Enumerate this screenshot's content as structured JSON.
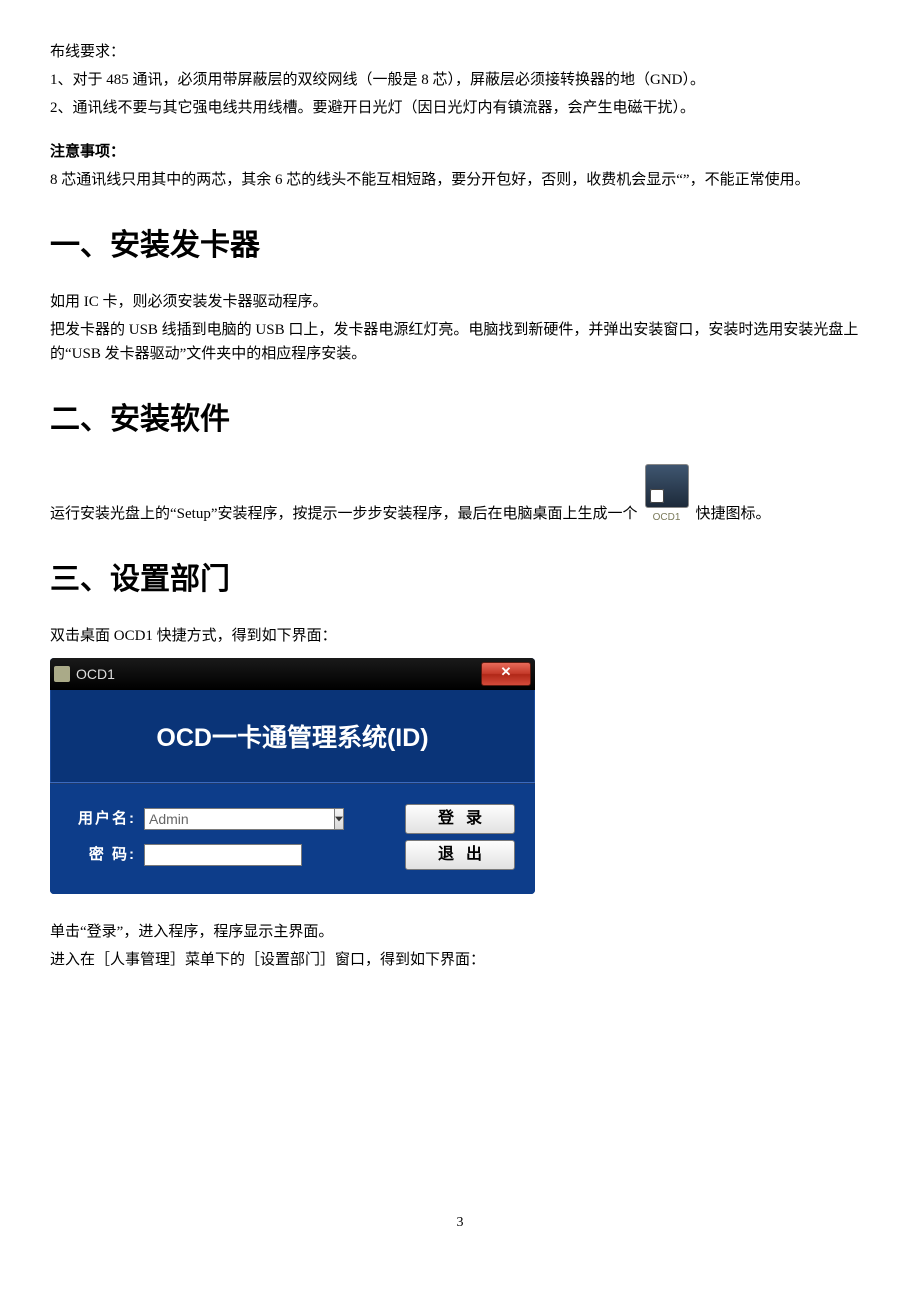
{
  "wiring": {
    "title": "布线要求：",
    "item1": "1、对于 485 通讯，必须用带屏蔽层的双绞网线（一般是 8 芯），屏蔽层必须接转换器的地（GND）。",
    "item2": "2、通讯线不要与其它强电线共用线槽。要避开日光灯（因日光灯内有镇流器，会产生电磁干扰）。"
  },
  "notice": {
    "title": "注意事项：",
    "body": "8 芯通讯线只用其中的两芯，其余 6 芯的线头不能互相短路，要分开包好，否则，收费机会显示“”，不能正常使用。"
  },
  "section1": {
    "heading": "一、安装发卡器",
    "p1": "如用 IC 卡，则必须安装发卡器驱动程序。",
    "p2": "把发卡器的 USB 线插到电脑的 USB 口上，发卡器电源红灯亮。电脑找到新硬件，并弹出安装窗口，安装时选用安装光盘上的“USB 发卡器驱动”文件夹中的相应程序安装。"
  },
  "section2": {
    "heading": "二、安装软件",
    "pre": "运行安装光盘上的“Setup”安装程序，按提示一步步安装程序，最后在电脑桌面上生成一个",
    "icon_label": "OCD1",
    "post": "快捷图标。"
  },
  "section3": {
    "heading": "三、设置部门",
    "p1": "双击桌面 OCD1 快捷方式，得到如下界面：",
    "after1": "单击“登录”，进入程序，程序显示主界面。",
    "after2": "进入在［人事管理］菜单下的［设置部门］窗口，得到如下界面："
  },
  "login": {
    "window_title": "OCD1",
    "close_glyph": "✕",
    "app_title": "OCD一卡通管理系统(ID)",
    "user_label": "用户名:",
    "user_value": "Admin",
    "pwd_label": "密 码:",
    "login_btn": "登录",
    "exit_btn": "退出"
  },
  "page_number": "3"
}
